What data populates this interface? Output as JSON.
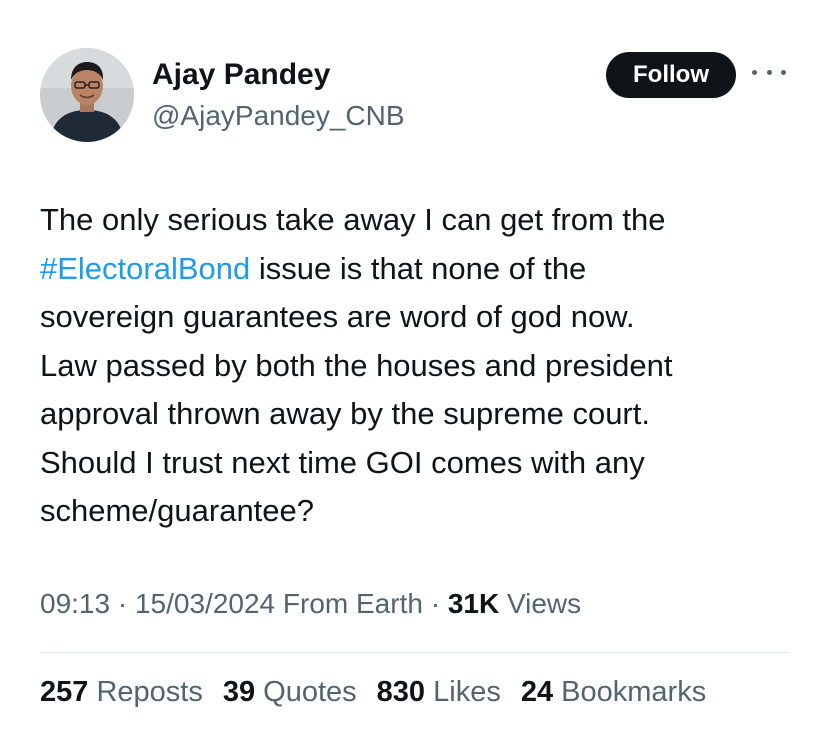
{
  "author": {
    "name": "Ajay Pandey",
    "handle": "@AjayPandey_CNB"
  },
  "follow_label": "Follow",
  "tweet": {
    "line1": "The only serious take away I can get from the",
    "hashtag": "#ElectoralBond",
    "line2_rest": " issue is that none of the",
    "line3": "sovereign guarantees are word of god now.",
    "line4": "Law passed by both the houses and president",
    "line5": "approval thrown away by the supreme court.",
    "line6": "Should I trust next time GOI comes with any",
    "line7": "scheme/guarantee?"
  },
  "meta": {
    "time": "09:13",
    "sep1": " · ",
    "date": "15/03/2024",
    "source": " From Earth",
    "sep2": " · ",
    "views_count": "31K",
    "views_label": " Views"
  },
  "stats": {
    "reposts_count": "257",
    "reposts_label": " Reposts",
    "quotes_count": "39",
    "quotes_label": " Quotes",
    "likes_count": "830",
    "likes_label": " Likes",
    "bookmarks_count": "24",
    "bookmarks_label": " Bookmarks"
  },
  "colors": {
    "link": "#1d9bf0",
    "text": "#0f1419",
    "secondary": "#536471",
    "button_bg": "#0f1419"
  },
  "icons": {
    "more": "more-horizontal-icon"
  }
}
